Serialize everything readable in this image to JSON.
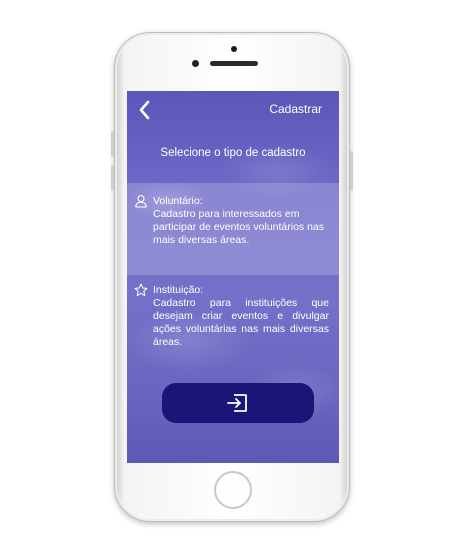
{
  "header": {
    "back_icon": "chevron-left-icon",
    "action_label": "Cadastrar"
  },
  "page": {
    "title": "Selecione o tipo de cadastro"
  },
  "options": [
    {
      "icon": "user-icon",
      "title": "Voluntário:",
      "description": "Cadastro para interessados em participar de eventos voluntários nas mais diversas áreas."
    },
    {
      "icon": "star-icon",
      "title": "Instituição:",
      "description": "Cadastro para instituições que desejam criar eventos e divulgar ações voluntárias nas mais diversas áreas."
    }
  ],
  "enter_button": {
    "icon": "sign-in-icon"
  },
  "colors": {
    "screen_background": "#6d67c6",
    "button": "#1a1577",
    "text": "#ffffff"
  }
}
